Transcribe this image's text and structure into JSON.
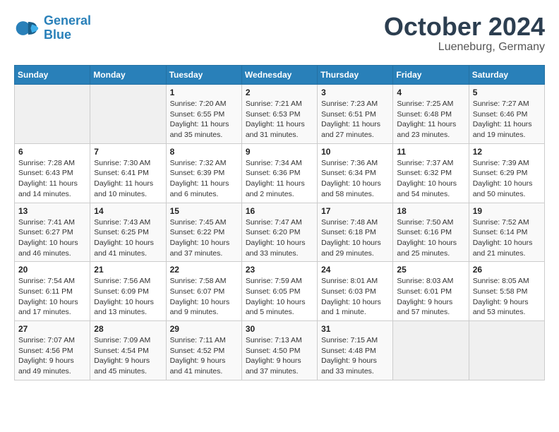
{
  "header": {
    "logo_line1": "General",
    "logo_line2": "Blue",
    "month": "October 2024",
    "location": "Lueneburg, Germany"
  },
  "weekdays": [
    "Sunday",
    "Monday",
    "Tuesday",
    "Wednesday",
    "Thursday",
    "Friday",
    "Saturday"
  ],
  "weeks": [
    [
      {
        "day": null
      },
      {
        "day": null
      },
      {
        "day": "1",
        "sunrise": "7:20 AM",
        "sunset": "6:55 PM",
        "daylight": "11 hours and 35 minutes."
      },
      {
        "day": "2",
        "sunrise": "7:21 AM",
        "sunset": "6:53 PM",
        "daylight": "11 hours and 31 minutes."
      },
      {
        "day": "3",
        "sunrise": "7:23 AM",
        "sunset": "6:51 PM",
        "daylight": "11 hours and 27 minutes."
      },
      {
        "day": "4",
        "sunrise": "7:25 AM",
        "sunset": "6:48 PM",
        "daylight": "11 hours and 23 minutes."
      },
      {
        "day": "5",
        "sunrise": "7:27 AM",
        "sunset": "6:46 PM",
        "daylight": "11 hours and 19 minutes."
      }
    ],
    [
      {
        "day": "6",
        "sunrise": "7:28 AM",
        "sunset": "6:43 PM",
        "daylight": "11 hours and 14 minutes."
      },
      {
        "day": "7",
        "sunrise": "7:30 AM",
        "sunset": "6:41 PM",
        "daylight": "11 hours and 10 minutes."
      },
      {
        "day": "8",
        "sunrise": "7:32 AM",
        "sunset": "6:39 PM",
        "daylight": "11 hours and 6 minutes."
      },
      {
        "day": "9",
        "sunrise": "7:34 AM",
        "sunset": "6:36 PM",
        "daylight": "11 hours and 2 minutes."
      },
      {
        "day": "10",
        "sunrise": "7:36 AM",
        "sunset": "6:34 PM",
        "daylight": "10 hours and 58 minutes."
      },
      {
        "day": "11",
        "sunrise": "7:37 AM",
        "sunset": "6:32 PM",
        "daylight": "10 hours and 54 minutes."
      },
      {
        "day": "12",
        "sunrise": "7:39 AM",
        "sunset": "6:29 PM",
        "daylight": "10 hours and 50 minutes."
      }
    ],
    [
      {
        "day": "13",
        "sunrise": "7:41 AM",
        "sunset": "6:27 PM",
        "daylight": "10 hours and 46 minutes."
      },
      {
        "day": "14",
        "sunrise": "7:43 AM",
        "sunset": "6:25 PM",
        "daylight": "10 hours and 41 minutes."
      },
      {
        "day": "15",
        "sunrise": "7:45 AM",
        "sunset": "6:22 PM",
        "daylight": "10 hours and 37 minutes."
      },
      {
        "day": "16",
        "sunrise": "7:47 AM",
        "sunset": "6:20 PM",
        "daylight": "10 hours and 33 minutes."
      },
      {
        "day": "17",
        "sunrise": "7:48 AM",
        "sunset": "6:18 PM",
        "daylight": "10 hours and 29 minutes."
      },
      {
        "day": "18",
        "sunrise": "7:50 AM",
        "sunset": "6:16 PM",
        "daylight": "10 hours and 25 minutes."
      },
      {
        "day": "19",
        "sunrise": "7:52 AM",
        "sunset": "6:14 PM",
        "daylight": "10 hours and 21 minutes."
      }
    ],
    [
      {
        "day": "20",
        "sunrise": "7:54 AM",
        "sunset": "6:11 PM",
        "daylight": "10 hours and 17 minutes."
      },
      {
        "day": "21",
        "sunrise": "7:56 AM",
        "sunset": "6:09 PM",
        "daylight": "10 hours and 13 minutes."
      },
      {
        "day": "22",
        "sunrise": "7:58 AM",
        "sunset": "6:07 PM",
        "daylight": "10 hours and 9 minutes."
      },
      {
        "day": "23",
        "sunrise": "7:59 AM",
        "sunset": "6:05 PM",
        "daylight": "10 hours and 5 minutes."
      },
      {
        "day": "24",
        "sunrise": "8:01 AM",
        "sunset": "6:03 PM",
        "daylight": "10 hours and 1 minute."
      },
      {
        "day": "25",
        "sunrise": "8:03 AM",
        "sunset": "6:01 PM",
        "daylight": "9 hours and 57 minutes."
      },
      {
        "day": "26",
        "sunrise": "8:05 AM",
        "sunset": "5:58 PM",
        "daylight": "9 hours and 53 minutes."
      }
    ],
    [
      {
        "day": "27",
        "sunrise": "7:07 AM",
        "sunset": "4:56 PM",
        "daylight": "9 hours and 49 minutes."
      },
      {
        "day": "28",
        "sunrise": "7:09 AM",
        "sunset": "4:54 PM",
        "daylight": "9 hours and 45 minutes."
      },
      {
        "day": "29",
        "sunrise": "7:11 AM",
        "sunset": "4:52 PM",
        "daylight": "9 hours and 41 minutes."
      },
      {
        "day": "30",
        "sunrise": "7:13 AM",
        "sunset": "4:50 PM",
        "daylight": "9 hours and 37 minutes."
      },
      {
        "day": "31",
        "sunrise": "7:15 AM",
        "sunset": "4:48 PM",
        "daylight": "9 hours and 33 minutes."
      },
      {
        "day": null
      },
      {
        "day": null
      }
    ]
  ]
}
